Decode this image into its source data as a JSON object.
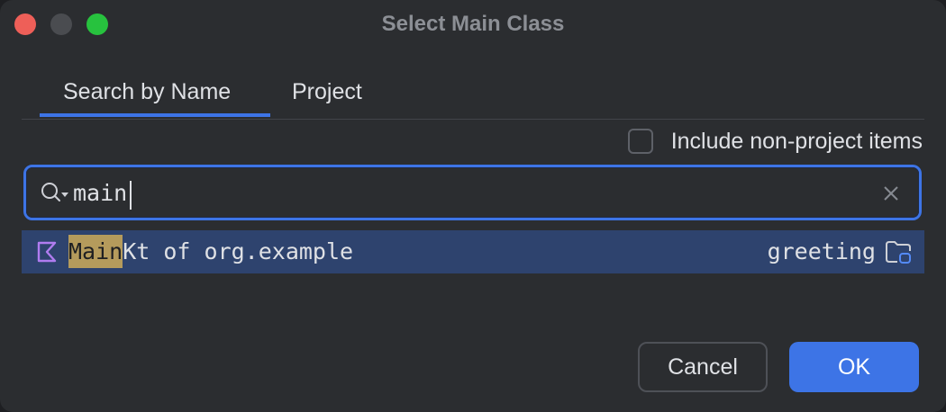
{
  "window": {
    "title": "Select Main Class"
  },
  "tabs": [
    {
      "label": "Search by Name",
      "selected": true
    },
    {
      "label": "Project",
      "selected": false
    }
  ],
  "options": {
    "include_non_project_label": "Include non-project items",
    "include_non_project_checked": false
  },
  "search": {
    "value": "main",
    "placeholder": ""
  },
  "results": [
    {
      "match": "Main",
      "rest": "Kt of org.example",
      "module": "greeting",
      "icon": "kotlin-file-icon"
    }
  ],
  "buttons": {
    "cancel": "Cancel",
    "ok": "OK"
  },
  "colors": {
    "accent": "#3d74e6",
    "selection": "#2e436e",
    "match_highlight": "#b59b5c"
  }
}
